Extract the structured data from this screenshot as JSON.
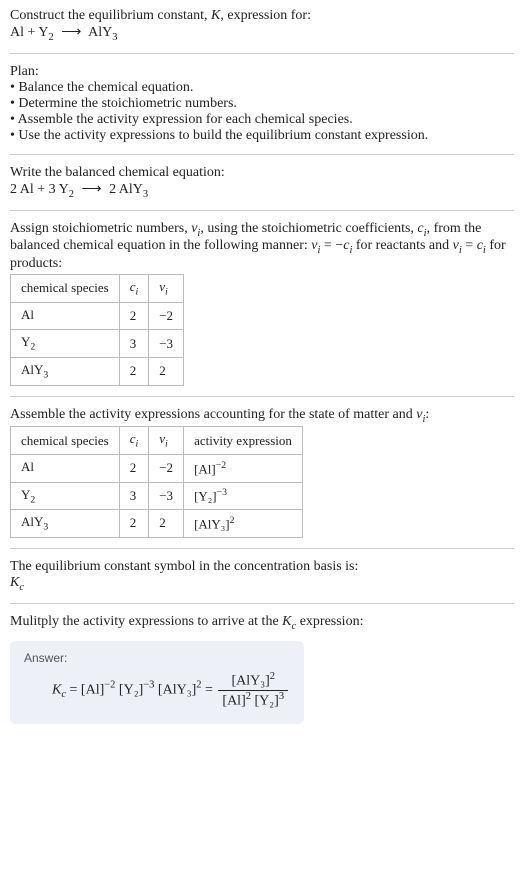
{
  "header": {
    "prompt": "Construct the equilibrium constant, K, expression for:",
    "equation_lhs_1": "Al",
    "equation_plus": " + ",
    "equation_lhs_2": "Y",
    "equation_lhs_2_sub": "2",
    "arrow": "⟶",
    "equation_rhs": "AlY",
    "equation_rhs_sub": "3"
  },
  "plan": {
    "title": "Plan:",
    "items": [
      "Balance the chemical equation.",
      "Determine the stoichiometric numbers.",
      "Assemble the activity expression for each chemical species.",
      "Use the activity expressions to build the equilibrium constant expression."
    ]
  },
  "balanced": {
    "intro": "Write the balanced chemical equation:",
    "c1": "2 Al",
    "plus1": " + ",
    "c2": "3 Y",
    "c2_sub": "2",
    "arrow": "⟶",
    "c3": "2 AlY",
    "c3_sub": "3"
  },
  "stoich": {
    "intro_a": "Assign stoichiometric numbers, ",
    "intro_nu": "ν",
    "intro_nu_sub": "i",
    "intro_b": ", using the stoichiometric coefficients, ",
    "intro_c": "c",
    "intro_c_sub": "i",
    "intro_d": ", from the balanced chemical equation in the following manner: ",
    "rel1_a": "ν",
    "rel1_a_sub": "i",
    "rel1_eq": " = −",
    "rel1_b": "c",
    "rel1_b_sub": "i",
    "intro_e": " for reactants and ",
    "rel2_a": "ν",
    "rel2_a_sub": "i",
    "rel2_eq": " = ",
    "rel2_b": "c",
    "rel2_b_sub": "i",
    "intro_f": " for products:",
    "table": {
      "h1": "chemical species",
      "h2": "c",
      "h2_sub": "i",
      "h3": "ν",
      "h3_sub": "i",
      "rows": [
        {
          "sp": "Al",
          "sp_sub": "",
          "c": "2",
          "nu": "−2"
        },
        {
          "sp": "Y",
          "sp_sub": "2",
          "c": "3",
          "nu": "−3"
        },
        {
          "sp": "AlY",
          "sp_sub": "3",
          "c": "2",
          "nu": "2"
        }
      ]
    }
  },
  "activity": {
    "intro_a": "Assemble the activity expressions accounting for the state of matter and ",
    "intro_nu": "ν",
    "intro_nu_sub": "i",
    "intro_b": ":",
    "table": {
      "h1": "chemical species",
      "h2": "c",
      "h2_sub": "i",
      "h3": "ν",
      "h3_sub": "i",
      "h4": "activity expression",
      "rows": [
        {
          "sp": "Al",
          "sp_sub": "",
          "c": "2",
          "nu": "−2",
          "act_base": "[Al]",
          "act_exp": "−2"
        },
        {
          "sp": "Y",
          "sp_sub": "2",
          "c": "3",
          "nu": "−3",
          "act_base": "[Y₂]",
          "act_exp": "−3"
        },
        {
          "sp": "AlY",
          "sp_sub": "3",
          "c": "2",
          "nu": "2",
          "act_base": "[AlY₃]",
          "act_exp": "2"
        }
      ]
    }
  },
  "symbol": {
    "intro": "The equilibrium constant symbol in the concentration basis is:",
    "K": "K",
    "K_sub": "c"
  },
  "multiply": {
    "intro_a": "Mulitply the activity expressions to arrive at the ",
    "K": "K",
    "K_sub": "c",
    "intro_b": " expression:"
  },
  "answer": {
    "label": "Answer:",
    "K": "K",
    "K_sub": "c",
    "eq": " = ",
    "t1": "[Al]",
    "t1_exp": "−2",
    "sp": " ",
    "t2": "[Y₂]",
    "t2_exp": "−3",
    "t3": "[AlY₃]",
    "t3_exp": "2",
    "eq2": " = ",
    "num": "[AlY₃]",
    "num_exp": "2",
    "den1": "[Al]",
    "den1_exp": "2",
    "den2": "[Y₂]",
    "den2_exp": "3"
  }
}
